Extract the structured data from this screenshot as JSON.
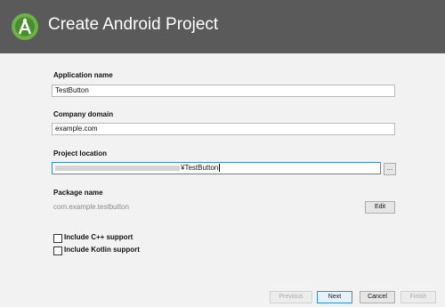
{
  "header": {
    "title": "Create Android Project",
    "logo_icon": "android-studio-icon",
    "background_color": "#5a5a5a"
  },
  "form": {
    "app_name": {
      "label": "Application name",
      "value": "TestButton"
    },
    "company_domain": {
      "label": "Company domain",
      "value": "example.com"
    },
    "project_location": {
      "label": "Project location",
      "value_suffix": "¥TestButton",
      "browse_label": "..."
    },
    "package_name": {
      "label": "Package name",
      "value": "com.example.testbutton",
      "edit_label": "Edit"
    },
    "options": [
      {
        "label": "Include C++ support",
        "checked": false
      },
      {
        "label": "Include Kotlin support",
        "checked": false
      }
    ]
  },
  "footer": {
    "previous": "Previous",
    "next": "Next",
    "cancel": "Cancel",
    "finish": "Finish"
  },
  "colors": {
    "focus_accent": "#3a8be0",
    "content_background": "#f2f2f2"
  }
}
